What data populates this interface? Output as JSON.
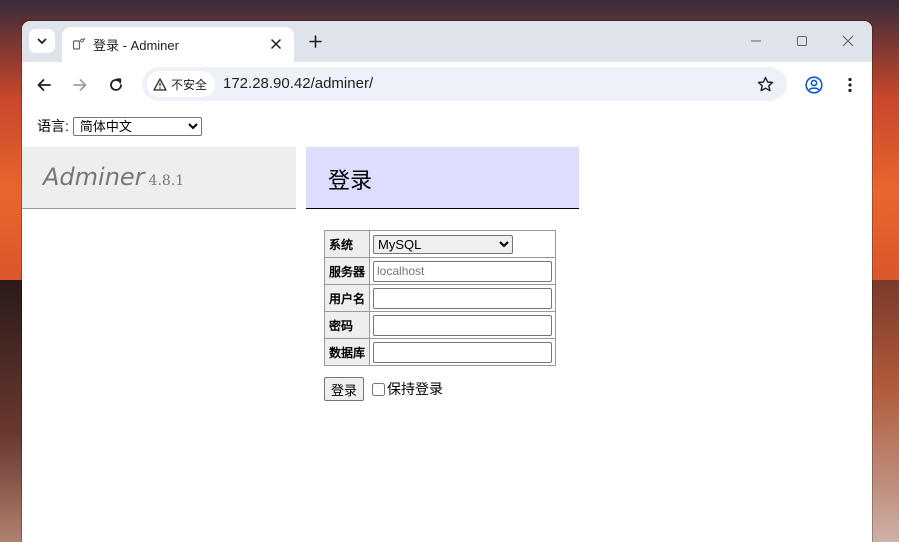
{
  "browser": {
    "tab_title": "登录 - Adminer",
    "security_label": "不安全",
    "url": "172.28.90.42/adminer/"
  },
  "page": {
    "lang_label": "语言:",
    "lang_selected": "简体中文",
    "brand": "Adminer",
    "version": "4.8.1",
    "heading": "登录",
    "form": {
      "system_label": "系统",
      "system_value": "MySQL",
      "server_label": "服务器",
      "server_placeholder": "localhost",
      "username_label": "用户名",
      "password_label": "密码",
      "database_label": "数据库",
      "submit_label": "登录",
      "permanent_label": "保持登录"
    }
  },
  "icons": {
    "tab_dropdown": "chevron-down-icon",
    "favicon": "adminer-favicon-icon",
    "tab_close": "close-icon",
    "new_tab": "plus-icon",
    "minimize": "minimize-icon",
    "maximize": "maximize-icon",
    "close_window": "close-icon",
    "back": "arrow-left-icon",
    "forward": "arrow-right-icon",
    "reload": "reload-icon",
    "warning": "warning-icon",
    "bookmark": "star-icon",
    "profile": "profile-icon",
    "menu": "kebab-menu-icon"
  }
}
